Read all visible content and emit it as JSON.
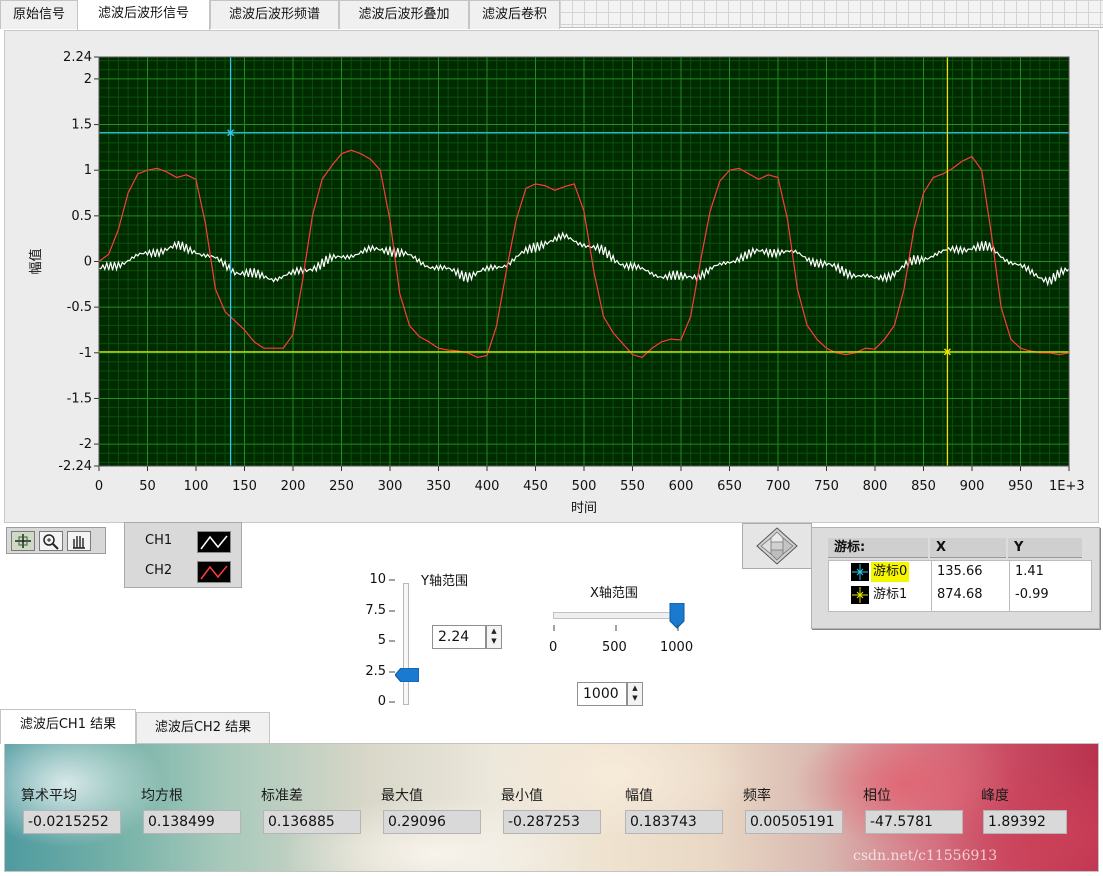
{
  "top_tabs": [
    {
      "label": "原始信号",
      "active": false
    },
    {
      "label": "滤波后波形信号",
      "active": true
    },
    {
      "label": "滤波后波形频谱",
      "active": false
    },
    {
      "label": "滤波后波形叠加",
      "active": false
    },
    {
      "label": "滤波后卷积",
      "active": false
    }
  ],
  "graph": {
    "xlabel": "时间",
    "ylabel": "幅值",
    "x_ticks": [
      "0",
      "50",
      "100",
      "150",
      "200",
      "250",
      "300",
      "350",
      "400",
      "450",
      "500",
      "550",
      "600",
      "650",
      "700",
      "750",
      "800",
      "850",
      "900",
      "950",
      "1E+3"
    ],
    "y_ticks": [
      "2.24",
      "2",
      "1.5",
      "1",
      "0.5",
      "0",
      "-0.5",
      "-1",
      "-1.5",
      "-2",
      "-2.24"
    ],
    "colors": {
      "plot_bg": "#002a00",
      "grid_major": "#1e8e1e",
      "grid_minor": "#0c500c",
      "ch1": "#ffffff",
      "ch2": "#ff3b3b",
      "cursor0": "#32c8e6",
      "cursor1": "#e6e600"
    }
  },
  "chart_data": {
    "type": "line",
    "xlabel": "时间",
    "ylabel": "幅值",
    "xlim": [
      0,
      1000
    ],
    "ylim": [
      -2.24,
      2.24
    ],
    "grid": true,
    "legend_placement": "bottom-left",
    "series": [
      {
        "name": "CH1",
        "x": [
          0,
          20,
          40,
          60,
          80,
          100,
          120,
          140,
          160,
          180,
          200,
          220,
          240,
          260,
          280,
          300,
          320,
          340,
          360,
          380,
          400,
          420,
          440,
          460,
          480,
          500,
          520,
          540,
          560,
          580,
          600,
          620,
          640,
          660,
          680,
          700,
          720,
          740,
          760,
          780,
          800,
          820,
          840,
          860,
          880,
          900,
          920,
          940,
          960,
          980,
          1000
        ],
        "y": [
          -0.1,
          -0.02,
          0.05,
          0.12,
          0.16,
          0.12,
          0.02,
          -0.1,
          -0.15,
          -0.18,
          -0.14,
          -0.06,
          0.02,
          0.08,
          0.12,
          0.14,
          0.05,
          -0.04,
          -0.1,
          -0.15,
          -0.1,
          -0.02,
          0.1,
          0.22,
          0.26,
          0.2,
          0.1,
          -0.02,
          -0.1,
          -0.15,
          -0.18,
          -0.14,
          -0.05,
          0.05,
          0.1,
          0.12,
          0.08,
          0.0,
          -0.08,
          -0.14,
          -0.2,
          -0.12,
          0.0,
          0.08,
          0.12,
          0.16,
          0.14,
          0.0,
          -0.12,
          -0.2,
          -0.1
        ]
      },
      {
        "name": "CH2",
        "x": [
          0,
          10,
          20,
          30,
          40,
          50,
          60,
          70,
          80,
          90,
          100,
          110,
          120,
          130,
          140,
          150,
          160,
          170,
          180,
          190,
          200,
          210,
          220,
          230,
          240,
          250,
          260,
          270,
          280,
          290,
          300,
          310,
          320,
          330,
          340,
          350,
          360,
          370,
          380,
          390,
          400,
          410,
          420,
          430,
          440,
          450,
          460,
          470,
          480,
          490,
          500,
          510,
          520,
          530,
          540,
          550,
          560,
          570,
          580,
          590,
          600,
          610,
          620,
          630,
          640,
          650,
          660,
          670,
          680,
          690,
          700,
          710,
          720,
          730,
          740,
          750,
          760,
          770,
          780,
          790,
          800,
          810,
          820,
          830,
          840,
          850,
          860,
          870,
          880,
          890,
          900,
          910,
          920,
          930,
          940,
          950,
          960,
          970,
          980,
          990,
          1000
        ],
        "y": [
          0.0,
          0.08,
          0.35,
          0.75,
          0.96,
          1.0,
          1.02,
          0.98,
          0.92,
          0.95,
          0.9,
          0.4,
          -0.3,
          -0.55,
          -0.65,
          -0.75,
          -0.88,
          -0.95,
          -0.95,
          -0.95,
          -0.8,
          -0.2,
          0.5,
          0.9,
          1.05,
          1.18,
          1.22,
          1.18,
          1.12,
          1.0,
          0.45,
          -0.35,
          -0.7,
          -0.82,
          -0.88,
          -0.95,
          -0.97,
          -0.98,
          -1.0,
          -1.05,
          -1.03,
          -0.7,
          -0.1,
          0.45,
          0.8,
          0.85,
          0.83,
          0.78,
          0.82,
          0.85,
          0.55,
          -0.1,
          -0.6,
          -0.78,
          -0.9,
          -1.02,
          -1.05,
          -0.95,
          -0.88,
          -0.85,
          -0.86,
          -0.6,
          0.0,
          0.55,
          0.88,
          1.0,
          1.02,
          0.96,
          0.9,
          0.95,
          0.92,
          0.45,
          -0.3,
          -0.7,
          -0.85,
          -0.95,
          -1.0,
          -1.02,
          -1.0,
          -0.95,
          -0.96,
          -0.85,
          -0.7,
          -0.3,
          0.35,
          0.75,
          0.92,
          0.96,
          1.02,
          1.1,
          1.15,
          1.0,
          0.3,
          -0.5,
          -0.85,
          -0.95,
          -0.98,
          -1.0,
          -1.0,
          -1.02,
          -1.0
        ]
      }
    ],
    "cursors": [
      {
        "name": "游标0",
        "x": 135.66,
        "y": 1.41
      },
      {
        "name": "游标1",
        "x": 874.68,
        "y": -0.99
      }
    ]
  },
  "legend": {
    "ch1": "CH1",
    "ch2": "CH2"
  },
  "cursor_table": {
    "header_name": "游标:",
    "header_x": "X",
    "header_y": "Y",
    "rows": [
      {
        "name": "游标0",
        "x": "135.66",
        "y": "1.41"
      },
      {
        "name": "游标1",
        "x": "874.68",
        "y": "-0.99"
      }
    ]
  },
  "y_range": {
    "label": "Y轴范围",
    "scale": [
      "10",
      "7.5",
      "5",
      "2.5",
      "0"
    ],
    "value": "2.24",
    "level": 2.24,
    "max": 10
  },
  "x_range": {
    "label": "X轴范围",
    "scale": [
      "0",
      "500",
      "1000"
    ],
    "value": "1000",
    "level": 1000,
    "max": 1000
  },
  "bottom_tabs": [
    {
      "label": "滤波后CH1 结果",
      "active": true
    },
    {
      "label": "滤波后CH2 结果",
      "active": false
    }
  ],
  "stats": [
    {
      "label": "算术平均",
      "value": "-0.0215252"
    },
    {
      "label": "均方根",
      "value": "0.138499"
    },
    {
      "label": "标准差",
      "value": "0.136885"
    },
    {
      "label": "最大值",
      "value": "0.29096"
    },
    {
      "label": "最小值",
      "value": "-0.287253"
    },
    {
      "label": "幅值",
      "value": "0.183743"
    },
    {
      "label": "频率",
      "value": "0.00505191"
    },
    {
      "label": "相位",
      "value": "-47.5781"
    },
    {
      "label": "峰度",
      "value": "1.89392"
    }
  ],
  "watermark": "csdn.net/c11556913"
}
